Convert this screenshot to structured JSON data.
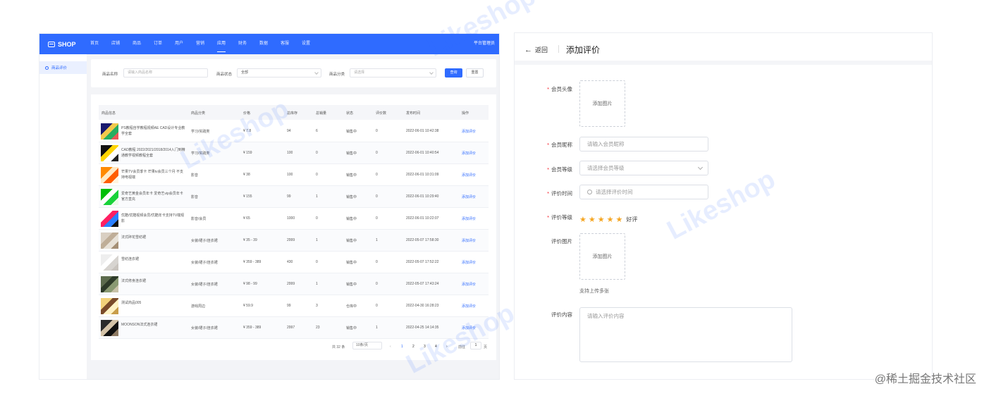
{
  "left": {
    "logo": "SHOP",
    "nav": [
      "首页",
      "店铺",
      "商品",
      "订单",
      "用户",
      "营销",
      "应用",
      "财务",
      "数据",
      "客服",
      "设置"
    ],
    "nav_active_index": 6,
    "admin": "平台管理员",
    "sidebar_item": "商品评价",
    "filters": {
      "name_label": "商品名称",
      "name_placeholder": "请输入商品名称",
      "status_label": "商品状态",
      "status_value": "全部",
      "category_label": "商品分类",
      "category_placeholder": "请选择",
      "query_button": "查询",
      "reset_button": "重置"
    },
    "table": {
      "headers": [
        "商品信息",
        "商品分类",
        "价格",
        "总库存",
        "总销量",
        "状态",
        "评价数",
        "发布时间",
        "操作"
      ],
      "rows": [
        {
          "name": "PS教程自学教程视频AE CAD设计专业教学全套",
          "category": "学习/实践类",
          "price": "¥ 7.8",
          "stock": "94",
          "sales": "6",
          "status": "销售中",
          "reviews": "0",
          "time": "2022-06-01 10:42:38",
          "action": "添加评价",
          "thumb_colors": [
            "#1a1a6e",
            "#f2c94c",
            "#27ae60",
            "#eb5757"
          ]
        },
        {
          "name": "CAD教程 2022/2021/2018/2014入门到精通教学视频教程全套",
          "category": "学习/实践类",
          "price": "¥ 159",
          "stock": "100",
          "sales": "0",
          "status": "销售中",
          "reviews": "0",
          "time": "2022-06-01 10:40:54",
          "action": "添加评价",
          "thumb_colors": [
            "#111111",
            "#ffd400",
            "#ffffff",
            "#222222"
          ]
        },
        {
          "name": "芒果TV会员季卡 芒果tv会员三个月 不支持电视端",
          "category": "影音",
          "price": "¥ 38",
          "stock": "100",
          "sales": "0",
          "status": "销售中",
          "reviews": "0",
          "time": "2022-06-01 10:31:09",
          "action": "添加评价",
          "thumb_colors": [
            "#ff8a00",
            "#ffe9c4",
            "#ff5e00",
            "#fff4e0"
          ]
        },
        {
          "name": "爱奇艺黄金会员年卡 爱奇艺vip会员年卡官方直充",
          "category": "影音",
          "price": "¥ 155",
          "stock": "99",
          "sales": "1",
          "status": "销售中",
          "reviews": "0",
          "time": "2022-06-01 10:29:40",
          "action": "添加评价",
          "thumb_colors": [
            "#00be06",
            "#ffffff",
            "#19d23a",
            "#eafbe8"
          ]
        },
        {
          "name": "优酷/优酷视频会员/优酷年卡支持TV端观影",
          "category": "影音/会员",
          "price": "¥ 65",
          "stock": "1000",
          "sales": "0",
          "status": "销售中",
          "reviews": "0",
          "time": "2022-06-01 10:22:07",
          "action": "添加评价",
          "thumb_colors": [
            "#ffffff",
            "#ff1f63",
            "#2a7fff",
            "#111111"
          ]
        },
        {
          "name": "法式碎花雪纺裙",
          "category": "女装/裙子/连衣裙",
          "price": "¥ 35 - 39",
          "stock": "2999",
          "sales": "1",
          "status": "销售中",
          "reviews": "1",
          "time": "2022-05-07 17:58:30",
          "action": "添加评价",
          "thumb_colors": [
            "#d9cfc2",
            "#bfae98",
            "#e8e2d8",
            "#a58f75"
          ]
        },
        {
          "name": "雪纺连衣裙",
          "category": "女装/裙子/连衣裙",
          "price": "¥ 359 - 389",
          "stock": "430",
          "sales": "0",
          "status": "销售中",
          "reviews": "0",
          "time": "2022-05-07 17:52:22",
          "action": "添加评价",
          "thumb_colors": [
            "#eeeeee",
            "#ffffff",
            "#d7d4d0",
            "#c9c4be"
          ]
        },
        {
          "name": "法式修身连衣裙",
          "category": "女装/裙子/连衣裙",
          "price": "¥ 98 - 99",
          "stock": "2999",
          "sales": "1",
          "status": "销售中",
          "reviews": "0",
          "time": "2022-05-07 17:43:24",
          "action": "添加评价",
          "thumb_colors": [
            "#5c6b4d",
            "#2e3b29",
            "#8a9a72",
            "#c8c2a8"
          ]
        },
        {
          "name": "测试商品005",
          "category": "游戏周边",
          "price": "¥ 59.9",
          "stock": "99",
          "sales": "3",
          "status": "仓库中",
          "reviews": "0",
          "time": "2022-04-30 16:28:23",
          "action": "添加评价",
          "thumb_colors": [
            "#f2d27a",
            "#7a4b2a",
            "#fff2c4",
            "#c89d4a"
          ]
        },
        {
          "name": "MOONSON法式连衣裙",
          "category": "女装/裙子/连衣裙",
          "price": "¥ 359 - 389",
          "stock": "2997",
          "sales": "23",
          "status": "销售中",
          "reviews": "1",
          "time": "2022-04-25 14:14:35",
          "action": "添加评价",
          "thumb_colors": [
            "#2b2b2b",
            "#d4c3a8",
            "#111111",
            "#8d7a63"
          ]
        }
      ]
    },
    "pagination": {
      "total": "共 32 条",
      "page_size": "10条/页",
      "prev": "‹",
      "pages": [
        "1",
        "2",
        "3",
        "4"
      ],
      "next": "›",
      "goto_label": "前往",
      "goto_value": "1",
      "goto_suffix": "页"
    }
  },
  "right": {
    "back_label": "返回",
    "title": "添加评价",
    "avatar_label": "会员头像",
    "avatar_upload": "添加图片",
    "nickname_label": "会员昵称",
    "nickname_placeholder": "请输入会员昵称",
    "level_label": "会员等级",
    "level_placeholder": "请选择会员等级",
    "time_label": "评价时间",
    "time_placeholder": "请选择评价时间",
    "rating_label": "评价等级",
    "rating_value": 5,
    "rating_text": "好评",
    "images_label": "评价图片",
    "images_upload": "添加图片",
    "images_help": "支持上传多张",
    "content_label": "评价内容",
    "content_placeholder": "请输入评价内容",
    "required_mark": "*"
  },
  "watermark_text": "Likeshop",
  "footer_mark": "@稀土掘金技术社区",
  "colors": {
    "primary": "#2f6bff",
    "required": "#f5222d",
    "star": "#f5a623"
  }
}
